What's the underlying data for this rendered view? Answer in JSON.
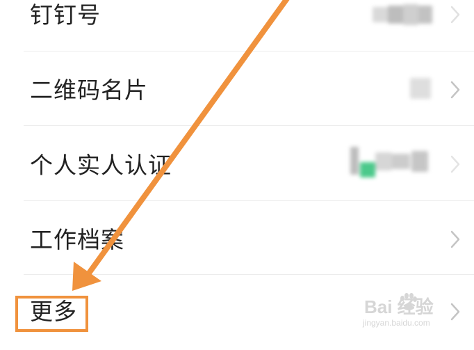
{
  "rows": [
    {
      "label": "钉钉号"
    },
    {
      "label": "二维码名片"
    },
    {
      "label": "个人实人认证"
    },
    {
      "label": "工作档案"
    },
    {
      "label": "更多"
    }
  ],
  "colors": {
    "annotation_orange": "#f0923d",
    "text": "#222222",
    "divider": "#ececec",
    "chevron": "#c4c4c4",
    "blur_green": "#4cc98b"
  },
  "watermark": {
    "main": "Bai 经验",
    "sub": "jingyan.baidu.com"
  }
}
